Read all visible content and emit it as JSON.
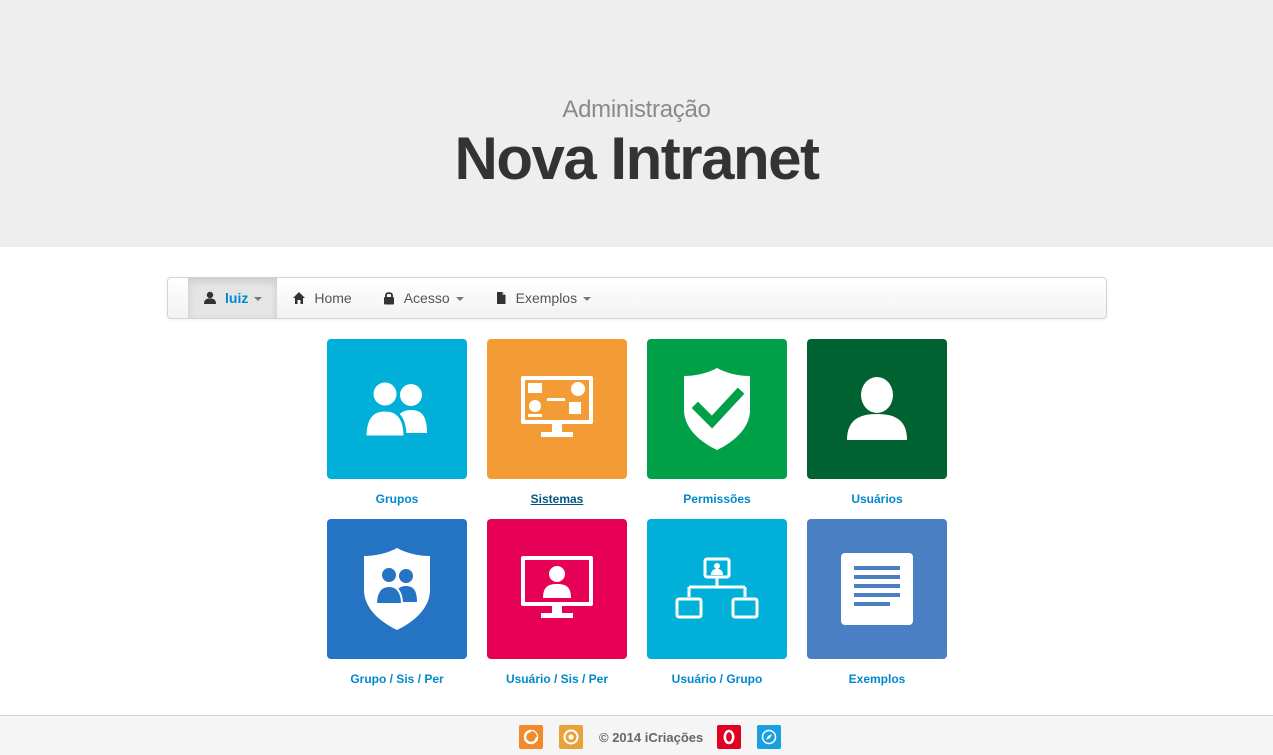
{
  "header": {
    "subtitle": "Administração",
    "title": "Nova Intranet"
  },
  "navbar": {
    "items": [
      {
        "label": "luiz",
        "icon": "user-icon",
        "dropdown": true
      },
      {
        "label": "Home",
        "icon": "home-icon",
        "dropdown": false
      },
      {
        "label": "Acesso",
        "icon": "lock-icon",
        "dropdown": true
      },
      {
        "label": "Exemplos",
        "icon": "document-icon",
        "dropdown": true
      }
    ]
  },
  "tiles": [
    {
      "label": "Grupos",
      "icon": "users-icon",
      "color": "#00b0d8"
    },
    {
      "label": "Sistemas",
      "icon": "dashboard-monitor-icon",
      "color": "#f39c35"
    },
    {
      "label": "Permissões",
      "icon": "shield-check-icon",
      "color": "#00a049"
    },
    {
      "label": "Usuários",
      "icon": "user-icon",
      "color": "#006131"
    },
    {
      "label": "Grupo / Sis / Per",
      "icon": "shield-users-icon",
      "color": "#2574c4"
    },
    {
      "label": "Usuário / Sis / Per",
      "icon": "monitor-user-icon",
      "color": "#e60056"
    },
    {
      "label": "Usuário / Grupo",
      "icon": "org-chart-icon",
      "color": "#00b0d8"
    },
    {
      "label": "Exemplos",
      "icon": "document-lines-icon",
      "color": "#4a7fc4"
    }
  ],
  "footer": {
    "copyright": "©  2014 iCriações",
    "browsers": [
      {
        "name": "firefox-icon",
        "color": "#f08a2b"
      },
      {
        "name": "chrome-icon",
        "color": "#e7a23a"
      },
      {
        "name": "opera-icon",
        "color": "#e00020"
      },
      {
        "name": "safari-icon",
        "color": "#1aa0e0"
      }
    ]
  }
}
